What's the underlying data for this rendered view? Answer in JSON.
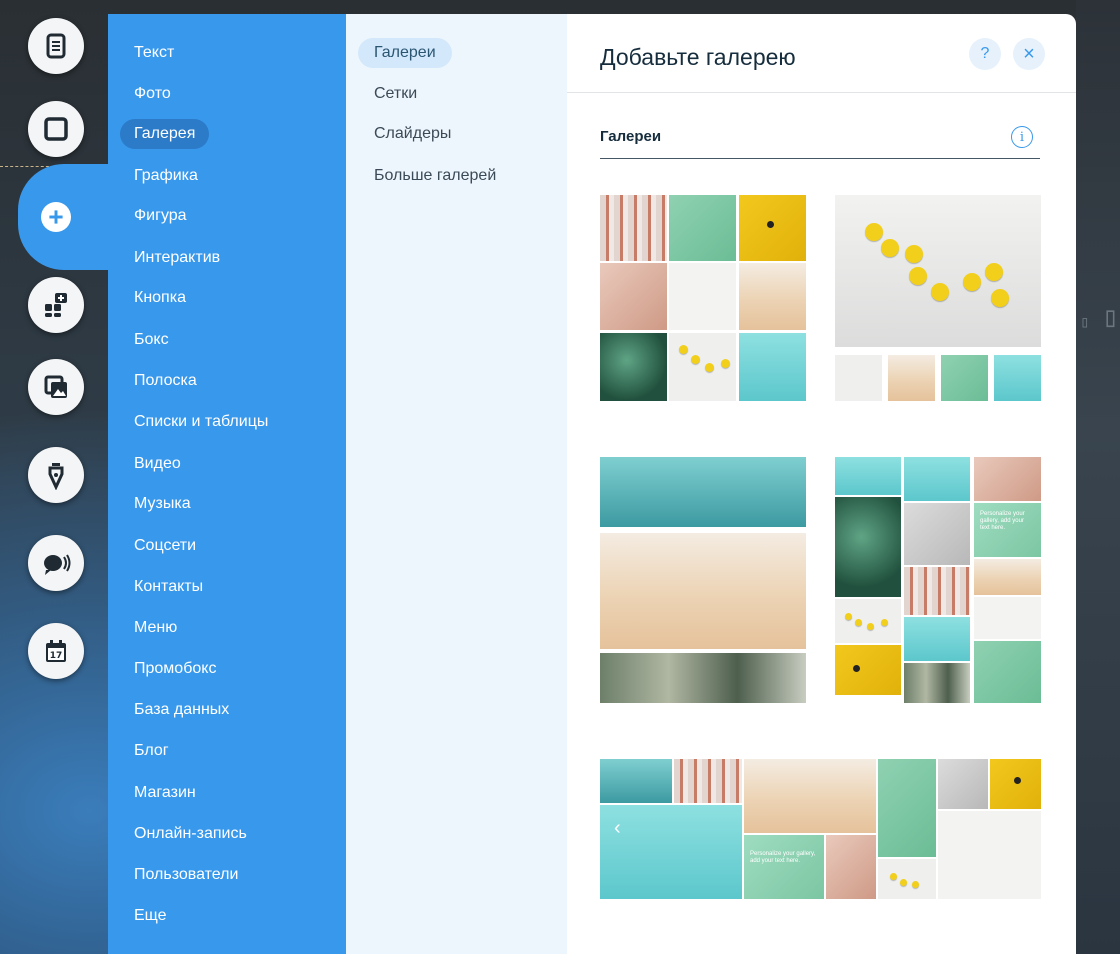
{
  "rail": {
    "icons": [
      "page-icon",
      "strip-icon",
      "add-icon",
      "apps-icon",
      "media-icon",
      "pen-icon",
      "chat-icon",
      "calendar-icon"
    ],
    "calendar_number": "17"
  },
  "categories": {
    "items": [
      "Текст",
      "Фото",
      "Галерея",
      "Графика",
      "Фигура",
      "Интерактив",
      "Кнопка",
      "Бокс",
      "Полоска",
      "Списки и таблицы",
      "Видео",
      "Музыка",
      "Соцсети",
      "Контакты",
      "Меню",
      "Промобокс",
      "База данных",
      "Блог",
      "Магазин",
      "Онлайн-запись",
      "Пользователи",
      "Еще"
    ],
    "selected": "Галерея"
  },
  "subcategories": {
    "items": [
      "Галереи",
      "Сетки",
      "Слайдеры",
      "Больше галерей"
    ],
    "selected": "Галереи"
  },
  "panel": {
    "title": "Добавьте галерею",
    "help_label": "?",
    "close_label": "×",
    "section_title": "Галереи",
    "info_label": "i",
    "overlay_text": "Personalize your gallery, add your text here.",
    "slider_arrow": "‹"
  },
  "colors": {
    "accent": "#3899ec",
    "accent_dark": "#2b7bc9",
    "subpanel_bg": "#eef6fd",
    "title_text": "#162d3d"
  }
}
